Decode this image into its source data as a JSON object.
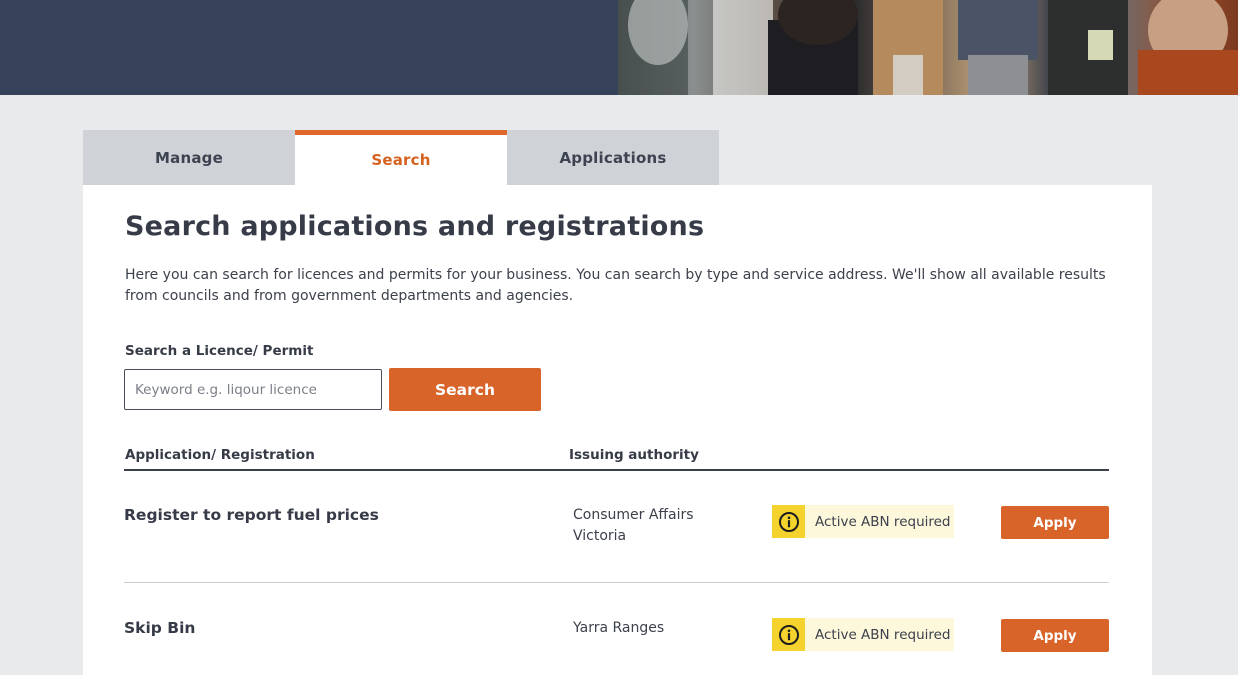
{
  "tabs": [
    {
      "label": "Manage"
    },
    {
      "label": "Search"
    },
    {
      "label": "Applications"
    }
  ],
  "page": {
    "title": "Search applications and registrations",
    "intro": "Here you can search for licences and permits for your business. You can search by type and service address. We'll show all available results from councils and from government departments and agencies."
  },
  "search": {
    "label": "Search a Licence/ Permit",
    "placeholder": "Keyword e.g. liqour licence",
    "value": "",
    "button_label": "Search"
  },
  "table": {
    "columns": [
      "Application/ Registration",
      "Issuing authority"
    ],
    "rows": [
      {
        "title": "Register to report fuel prices",
        "authority": "Consumer Affairs Victoria",
        "notice": "Active ABN required",
        "action": "Apply"
      },
      {
        "title": "Skip Bin",
        "authority": "Yarra Ranges",
        "notice": "Active ABN required",
        "action": "Apply"
      }
    ]
  },
  "colors": {
    "header_bg": "#354259",
    "accent": "#d8642a",
    "notice_icon_bg": "#f5d32e",
    "notice_bg": "#fdf7dc"
  },
  "icons": {
    "notice": "info-icon"
  }
}
